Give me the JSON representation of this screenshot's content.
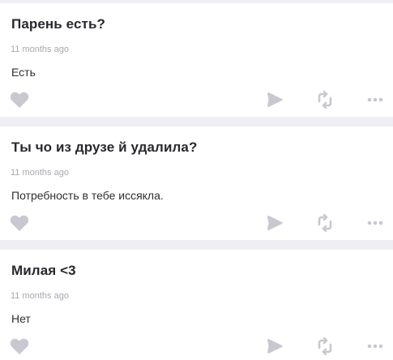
{
  "icons": {
    "like": "heart-icon",
    "share": "share-arrow-icon",
    "repost": "repost-icon",
    "more": "more-dots-icon"
  },
  "colors": {
    "icon": "#c9c8d1",
    "question": "#28282e",
    "time": "#a8a8b0",
    "background": "#efeff3"
  },
  "feed": {
    "items": [
      {
        "question": "Парень есть?",
        "time": "11 months ago",
        "answer": "Есть"
      },
      {
        "question": "Ты чо из друзе й удалила?",
        "time": "11 months ago",
        "answer": "Потребность в тебе иссякла."
      },
      {
        "question": "Милая <3",
        "time": "11 months ago",
        "answer": "Нет"
      }
    ]
  }
}
